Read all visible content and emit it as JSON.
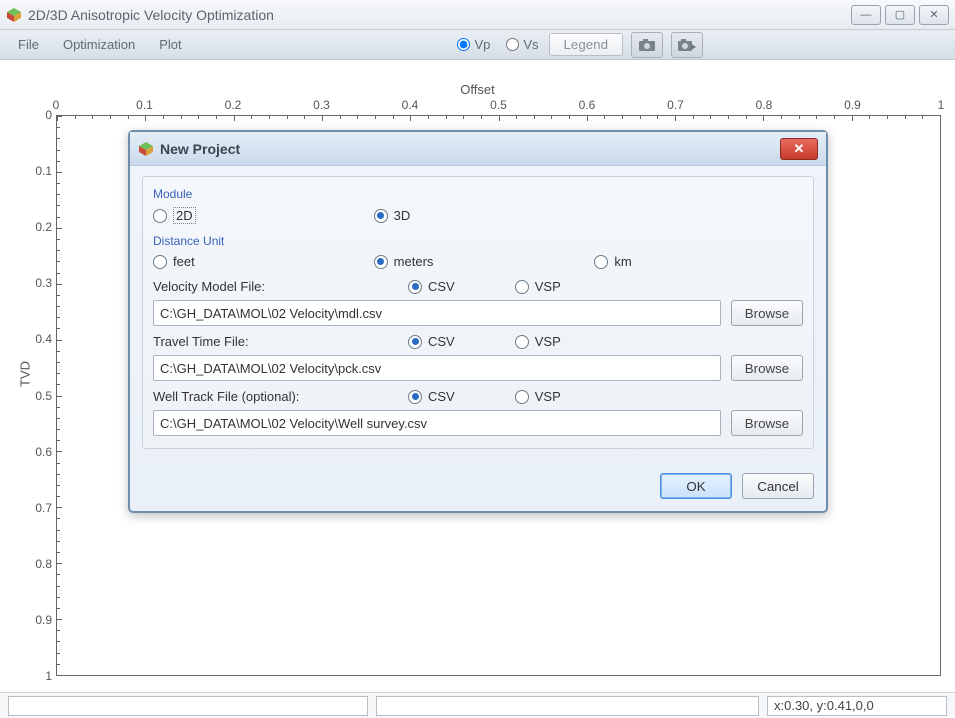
{
  "window": {
    "title": "2D/3D Anisotropic Velocity Optimization",
    "buttons": {
      "min": "—",
      "max": "▢",
      "close": "✕"
    }
  },
  "menu": {
    "file": "File",
    "optimization": "Optimization",
    "plot": "Plot"
  },
  "toolbar": {
    "vp": "Vp",
    "vs": "Vs",
    "legend": "Legend"
  },
  "chart": {
    "xlabel": "Offset",
    "ylabel": "TVD"
  },
  "chart_data": {
    "type": "scatter",
    "title": "",
    "xlabel": "Offset",
    "ylabel": "TVD",
    "xlim": [
      0,
      1
    ],
    "ylim": [
      0,
      1
    ],
    "xticks": [
      0,
      0.1,
      0.2,
      0.3,
      0.4,
      0.5,
      0.6,
      0.7,
      0.8,
      0.9,
      1
    ],
    "yticks": [
      0,
      0.1,
      0.2,
      0.3,
      0.4,
      0.5,
      0.6,
      0.7,
      0.8,
      0.9,
      1
    ],
    "series": []
  },
  "status": {
    "coord": "x:0.30, y:0.41,0,0"
  },
  "dialog": {
    "title": "New Project",
    "module_label": "Module",
    "module_2d": "2D",
    "module_3d": "3D",
    "module_selected": "3D",
    "unit_label": "Distance Unit",
    "unit_feet": "feet",
    "unit_meters": "meters",
    "unit_km": "km",
    "unit_selected": "meters",
    "vel_label": "Velocity Model File:",
    "tt_label": "Travel Time File:",
    "well_label": "Well Track File (optional):",
    "fmt_csv": "CSV",
    "fmt_vsp": "VSP",
    "vel_fmt": "CSV",
    "tt_fmt": "CSV",
    "well_fmt": "CSV",
    "vel_path": "C:\\GH_DATA\\MOL\\02 Velocity\\mdl.csv",
    "tt_path": "C:\\GH_DATA\\MOL\\02 Velocity\\pck.csv",
    "well_path": "C:\\GH_DATA\\MOL\\02 Velocity\\Well survey.csv",
    "browse": "Browse",
    "ok": "OK",
    "cancel": "Cancel"
  }
}
